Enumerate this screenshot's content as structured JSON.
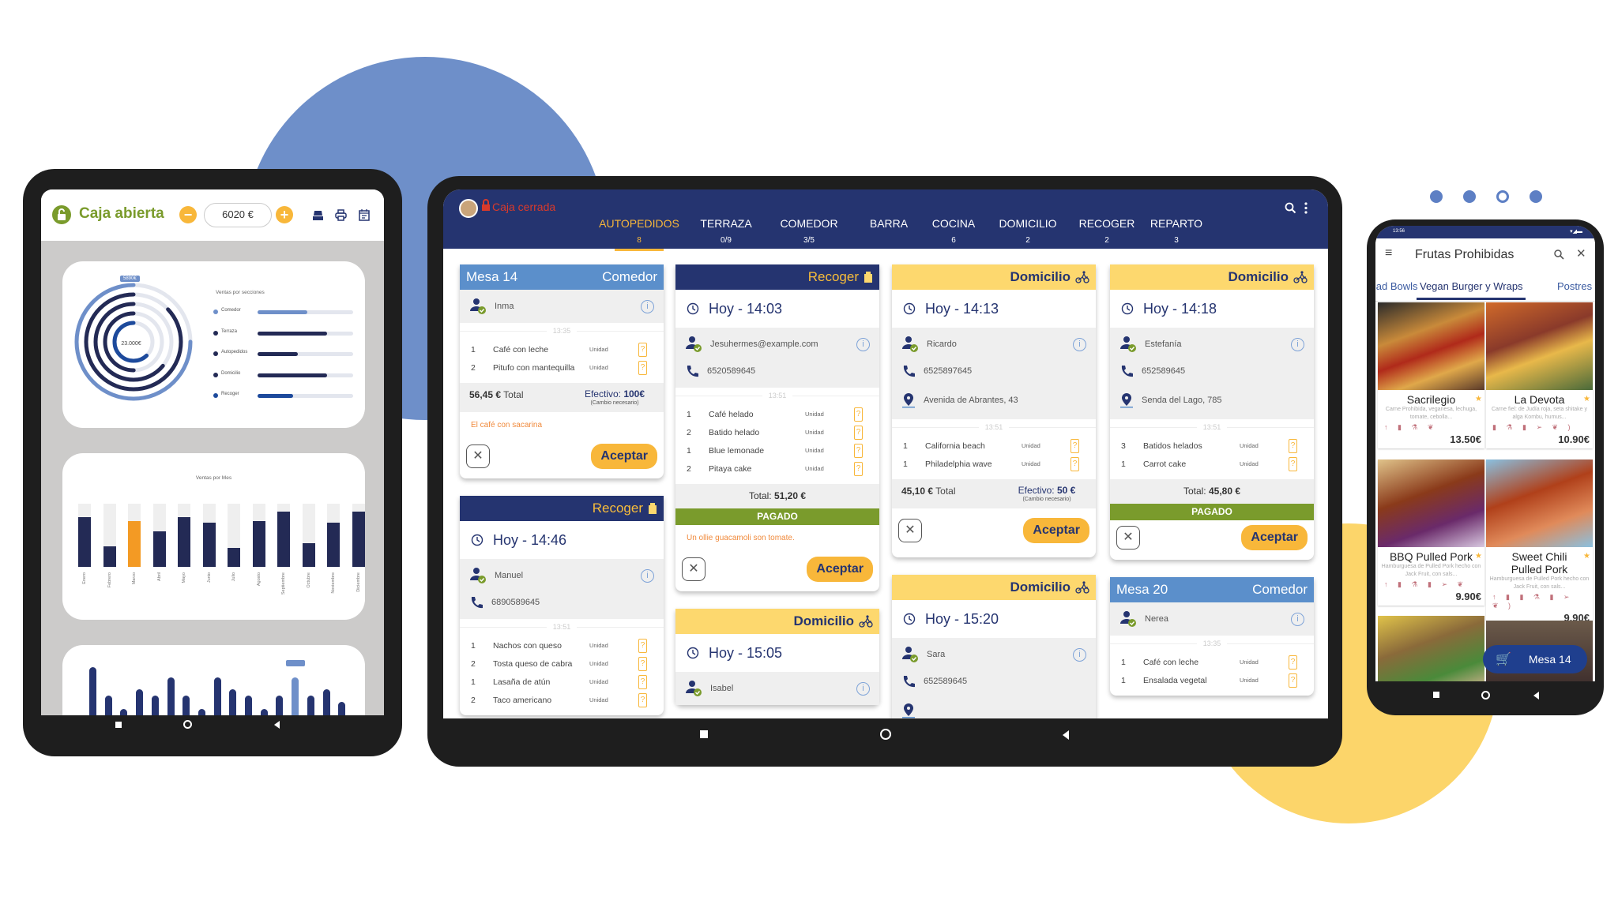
{
  "colors": {
    "navy": "#253470",
    "accent": "#f8b73a",
    "green": "#7a9b2c",
    "light_blue": "#5b8fcb",
    "domicilio": "#fdd86e",
    "closed_red": "#d93a2b"
  },
  "pager_dots": [
    {
      "active": false
    },
    {
      "active": false
    },
    {
      "active": true
    },
    {
      "active": false
    }
  ],
  "dashboard": {
    "status": "Caja abierta",
    "cash_value": "6020 €",
    "minus_icon": "minus-circle-icon",
    "plus_icon": "plus-circle-icon",
    "toolbar_icons": [
      "cash-register-icon",
      "printer-icon",
      "calendar-icon"
    ],
    "sections_chart": {
      "title": "Ventas por secciones",
      "total": "23.000€",
      "tag": "5890€",
      "rings": [
        0.75,
        0.87,
        0.64,
        0.5,
        0.62
      ],
      "legend": [
        {
          "label": "Comedor",
          "value": 0.52,
          "color": "#6e8fc9"
        },
        {
          "label": "Terraza",
          "value": 0.73,
          "color": "#232a55"
        },
        {
          "label": "Autopedidos",
          "value": 0.42,
          "color": "#232a55"
        },
        {
          "label": "Domicilio",
          "value": 0.73,
          "color": "#232a55"
        },
        {
          "label": "Recoger",
          "value": 0.37,
          "color": "#1d4a9c"
        }
      ]
    },
    "monthly_chart": {
      "title": "Ventas por Mes",
      "categories": [
        "Enero",
        "Febrero",
        "Marzo",
        "Abril",
        "Mayo",
        "Junio",
        "Julio",
        "Agosto",
        "Septiembre",
        "Octubre",
        "Noviembre",
        "Diciembre"
      ],
      "values": [
        0.79,
        0.33,
        0.72,
        0.56,
        0.79,
        0.7,
        0.3,
        0.72,
        0.88,
        0.37,
        0.7,
        0.88
      ],
      "highlight_index": 2
    },
    "daily_chart": {
      "values": [
        75,
        39,
        22,
        47,
        39,
        62,
        39,
        22,
        62,
        47,
        39,
        22,
        39,
        62,
        39,
        47,
        31
      ],
      "highlight_index": 13
    }
  },
  "pos": {
    "status": "Caja cerrada",
    "tabs": [
      {
        "label": "AUTOPEDIDOS",
        "count": "8",
        "active": true
      },
      {
        "label": "TERRAZA",
        "count": "0/9"
      },
      {
        "label": "COMEDOR",
        "count": "3/5"
      },
      {
        "label": "BARRA",
        "count": ""
      },
      {
        "label": "COCINA",
        "count": "6"
      },
      {
        "label": "DOMICILIO",
        "count": "2"
      },
      {
        "label": "RECOGER",
        "count": "2"
      },
      {
        "label": "REPARTO",
        "count": "3"
      }
    ],
    "columns": [
      [
        {
          "type": "mesa",
          "header_left": "Mesa 14",
          "header_right": "Comedor",
          "customer": "Inma",
          "sep_time": "13:35",
          "items": [
            {
              "qty": "1",
              "name": "Café con leche",
              "unit": "Unidad"
            },
            {
              "qty": "2",
              "name": "Pitufo con mantequilla",
              "unit": "Unidad"
            }
          ],
          "total": {
            "amount": "56,45 €",
            "label": "Total",
            "payment_label": "Efectivo:",
            "payment_value": "100€",
            "payment_note": "(Cambio necesario)"
          },
          "note": "El café con sacarina",
          "accept": "Aceptar"
        },
        {
          "type": "recoger",
          "header_right": "Recoger",
          "time": "Hoy - 14:46",
          "customer": "Manuel",
          "phone": "6890589645",
          "sep_time": "13:51",
          "items": [
            {
              "qty": "1",
              "name": "Nachos con queso",
              "unit": "Unidad"
            },
            {
              "qty": "2",
              "name": "Tosta queso de cabra",
              "unit": "Unidad"
            },
            {
              "qty": "1",
              "name": "Lasaña de atún",
              "unit": "Unidad"
            },
            {
              "qty": "2",
              "name": "Taco americano",
              "unit": "Unidad"
            }
          ]
        }
      ],
      [
        {
          "type": "recoger",
          "header_right": "Recoger",
          "time": "Hoy - 14:03",
          "customer": "Jesuhermes@example.com",
          "phone": "6520589645",
          "sep_time": "13:51",
          "items": [
            {
              "qty": "1",
              "name": "Café helado",
              "unit": "Unidad"
            },
            {
              "qty": "2",
              "name": "Batido helado",
              "unit": "Unidad"
            },
            {
              "qty": "1",
              "name": "Blue lemonade",
              "unit": "Unidad"
            },
            {
              "qty": "2",
              "name": "Pitaya cake",
              "unit": "Unidad"
            }
          ],
          "total_line": {
            "label": "Total:",
            "amount": "51,20 €"
          },
          "paid": "PAGADO",
          "note": "Un ollie guacamoli son tomate.",
          "accept": "Aceptar"
        },
        {
          "type": "domicilio",
          "header_right": "Domicilio",
          "time": "Hoy - 15:05",
          "customer": "Isabel"
        }
      ],
      [
        {
          "type": "domicilio",
          "header_right": "Domicilio",
          "time": "Hoy - 14:13",
          "customer": "Ricardo",
          "phone": "6525897645",
          "address": "Avenida de Abrantes, 43",
          "sep_time": "13:51",
          "items": [
            {
              "qty": "1",
              "name": "California beach",
              "unit": "Unidad"
            },
            {
              "qty": "1",
              "name": "Philadelphia wave",
              "unit": "Unidad"
            }
          ],
          "total": {
            "amount": "45,10 €",
            "label": "Total",
            "payment_label": "Efectivo:",
            "payment_value": "50 €",
            "payment_note": "(Cambio necesario)"
          },
          "accept": "Aceptar"
        },
        {
          "type": "domicilio",
          "header_right": "Domicilio",
          "time": "Hoy - 15:20",
          "customer": "Sara",
          "phone": "652589645",
          "address": ""
        }
      ],
      [
        {
          "type": "domicilio",
          "header_right": "Domicilio",
          "time": "Hoy - 14:18",
          "customer": "Estefanía",
          "phone": "652589645",
          "address": "Senda del Lago, 785",
          "sep_time": "13:51",
          "items": [
            {
              "qty": "3",
              "name": "Batidos helados",
              "unit": "Unidad"
            },
            {
              "qty": "1",
              "name": "Carrot cake",
              "unit": "Unidad"
            }
          ],
          "total_line": {
            "label": "Total:",
            "amount": "45,80 €"
          },
          "paid": "PAGADO",
          "accept": "Aceptar"
        },
        {
          "type": "mesa",
          "header_left": "Mesa 20",
          "header_right": "Comedor",
          "customer": "Nerea",
          "sep_time": "13:35",
          "items": [
            {
              "qty": "1",
              "name": "Café con leche",
              "unit": "Unidad"
            },
            {
              "qty": "1",
              "name": "Ensalada vegetal",
              "unit": "Unidad"
            }
          ]
        }
      ]
    ]
  },
  "phone": {
    "clock": "13:56",
    "title": "Frutas Prohibidas",
    "tabs": [
      {
        "label": "Salad Bowls"
      },
      {
        "label": "Vegan Burger y Wraps",
        "active": true
      },
      {
        "label": "Postres"
      }
    ],
    "products": [
      {
        "name": "Sacrilegio",
        "desc": "Carne Prohibida, veganesa, lechuga, tomate, cebolla...",
        "price": "13.50€",
        "icons": "↑ ▮ ⚗ ❦"
      },
      {
        "name": "La Devota",
        "desc": "Carne fiel:  de Judía roja, seta shitake y alga Kombu, humus...",
        "price": "10.90€",
        "icons": "▮ ⚗ ▮ ➢ ❦ )"
      },
      {
        "name": "BBQ Pulled Pork",
        "desc": "Hamburguesa de Pulled Pork hecho con Jack Fruit, con sals...",
        "price": "9.90€",
        "icons": "↑ ▮ ⚗ ▮ ➢ ❦"
      },
      {
        "name": "Sweet Chili Pulled Pork",
        "desc": "Hamburguesa de Pulled Pork hecho con Jack Fruit, con sals...",
        "price": "9.90€",
        "icons": "↑ ▮ ▮ ⚗ ▮ ➢ ❦ )"
      }
    ],
    "fab_label": "Mesa 14"
  }
}
